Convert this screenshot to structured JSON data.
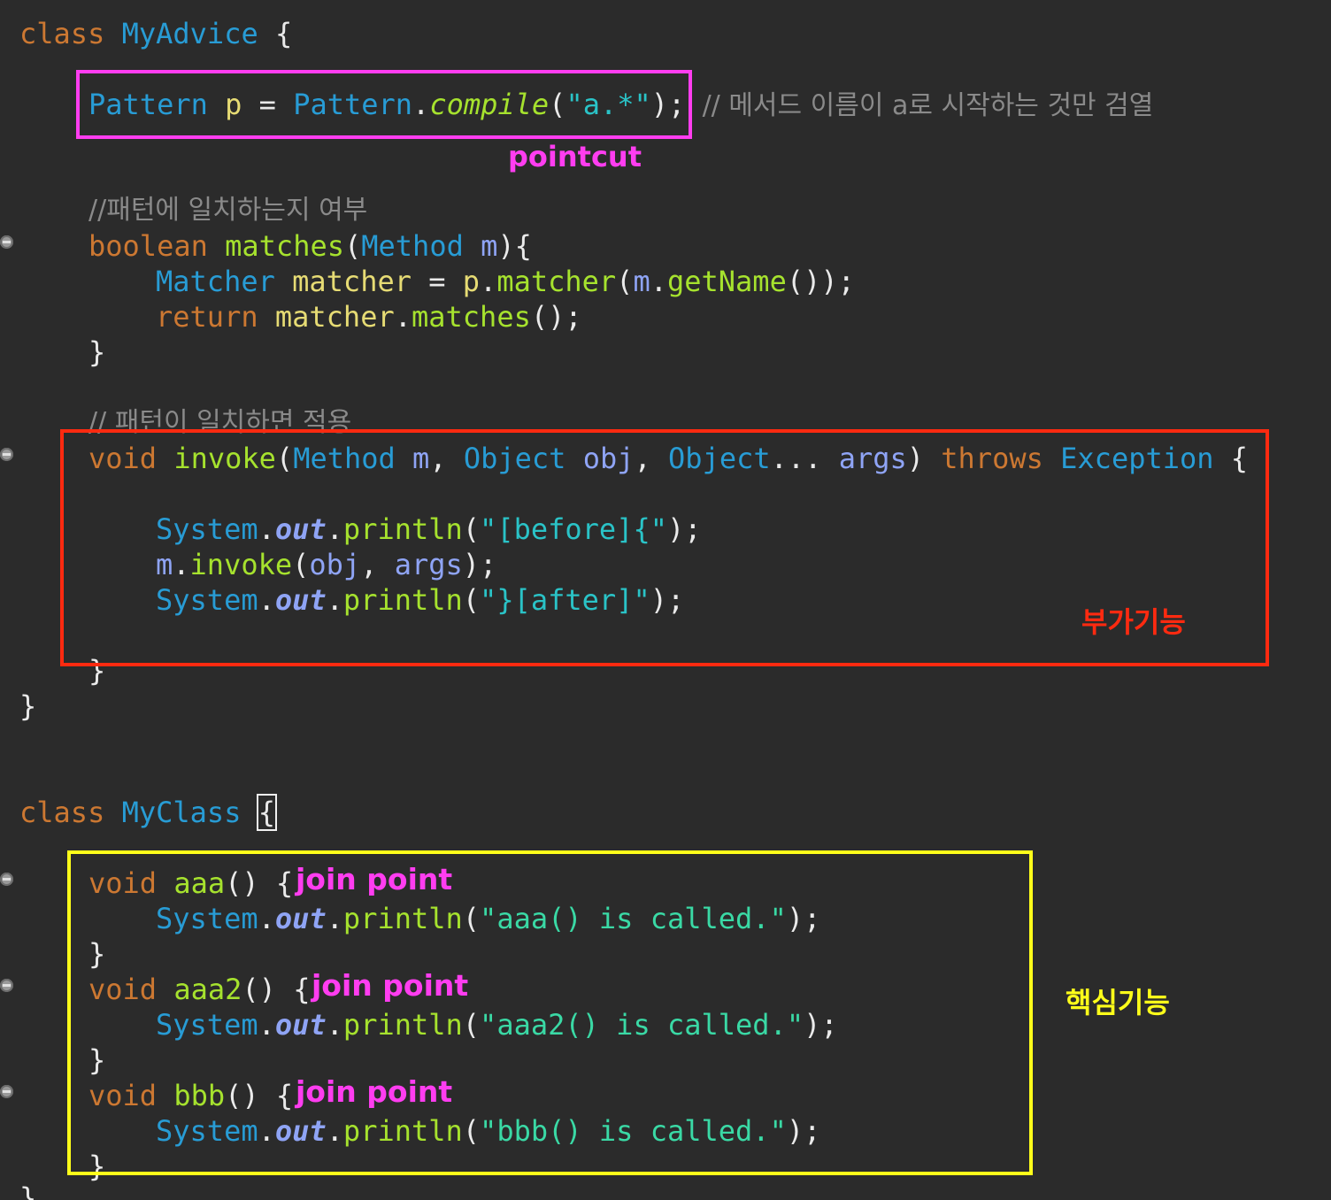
{
  "myadvice": {
    "class_kw": "class",
    "class_name": "MyAdvice",
    "open_brace": "{",
    "close_brace": "}",
    "field": {
      "type": "Pattern",
      "var": "p",
      "eq": "=",
      "class_ref": "Pattern",
      "dot": ".",
      "method": "compile",
      "lparen": "(",
      "arg": "\"a.*\"",
      "end": ");",
      "comment": "// 메서드 이름이 a로 시작하는 것만 검열"
    },
    "pointcut_label": "pointcut",
    "comment_match": "//패턴에 일치하는지 여부",
    "matches_method": {
      "ret": "boolean",
      "name": "matches",
      "lparen": "(",
      "ptype": "Method",
      "pname": "m",
      "rest": "){",
      "line1_type": "Matcher",
      "line1_var": "matcher",
      "line1_eq": "=",
      "line1_p": "p",
      "line1_dot": ".",
      "line1_call": "matcher",
      "line1_lparen": "(",
      "line1_m": "m",
      "line1_dot2": ".",
      "line1_getname": "getName",
      "line1_end": "());",
      "line2_return": "return",
      "line2_var": "matcher",
      "line2_dot": ".",
      "line2_call": "matches",
      "line2_end": "();",
      "close": "}"
    },
    "comment_apply": "// 패턴이 일치하면 적용",
    "invoke_method": {
      "ret": "void",
      "name": "invoke",
      "lparen": "(",
      "t1": "Method",
      "p1": "m",
      "comma1": ",",
      "t2": "Object",
      "p2": "obj",
      "comma2": ",",
      "t3": "Object",
      "dots": "...",
      "p3": "args",
      "rparen": ")",
      "throws_kw": "throws",
      "exc": "Exception",
      "brace": "{",
      "sys1_obj": "System",
      "sys1_dot": ".",
      "sys1_out": "out",
      "sys1_dot2": ".",
      "sys1_println": "println",
      "sys1_lparen": "(",
      "sys1_str": "\"[before]{\"",
      "sys1_end": ");",
      "call_m": "m",
      "call_dot": ".",
      "call_invoke": "invoke",
      "call_lparen": "(",
      "call_obj": "obj",
      "call_comma": ",",
      "call_args": "args",
      "call_end": ");",
      "sys2_obj": "System",
      "sys2_dot": ".",
      "sys2_out": "out",
      "sys2_dot2": ".",
      "sys2_println": "println",
      "sys2_lparen": "(",
      "sys2_str": "\"}[after]\"",
      "sys2_end": ");",
      "close": "}"
    },
    "advice_label": "부가기능"
  },
  "myclass": {
    "class_kw": "class",
    "class_name": "MyClass",
    "open_brace": "{",
    "methods": [
      {
        "ret": "void",
        "name": "aaa",
        "sig_end": "() {",
        "join_label": "join point",
        "sys_obj": "System",
        "dot": ".",
        "out": "out",
        "dot2": ".",
        "println": "println",
        "lparen": "(",
        "str": "\"aaa() is called.\"",
        "end": ");",
        "close": "}"
      },
      {
        "ret": "void",
        "name": "aaa2",
        "sig_end": "() {",
        "join_label": "join point",
        "sys_obj": "System",
        "dot": ".",
        "out": "out",
        "dot2": ".",
        "println": "println",
        "lparen": "(",
        "str": "\"aaa2() is called.\"",
        "end": ");",
        "close": "}"
      },
      {
        "ret": "void",
        "name": "bbb",
        "sig_end": "() {",
        "join_label": "join point",
        "sys_obj": "System",
        "dot": ".",
        "out": "out",
        "dot2": ".",
        "println": "println",
        "lparen": "(",
        "str": "\"bbb() is called.\"",
        "end": ");",
        "close": "}"
      }
    ],
    "close_brace": "}",
    "core_label": "핵심기능"
  },
  "colors": {
    "background": "#2b2b2b",
    "pointcut_box": "#ff3df0",
    "advice_box": "#ff2a10",
    "joinpoint_box": "#ffff1a"
  },
  "icons": [
    "fold-collapse-icon"
  ]
}
